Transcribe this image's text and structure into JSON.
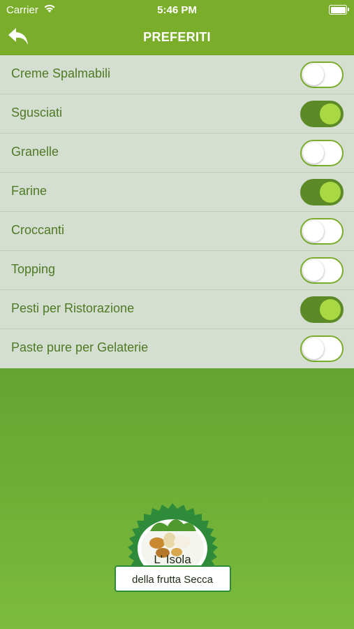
{
  "status_bar": {
    "carrier": "Carrier",
    "time": "5:46 PM"
  },
  "nav": {
    "title": "PREFERITI",
    "back_icon": "back-arrow-icon"
  },
  "items": [
    {
      "label": "Creme Spalmabili",
      "on": false
    },
    {
      "label": "Sgusciati",
      "on": true
    },
    {
      "label": "Granelle",
      "on": false
    },
    {
      "label": "Farine",
      "on": true
    },
    {
      "label": "Croccanti",
      "on": false
    },
    {
      "label": "Topping",
      "on": false
    },
    {
      "label": "Pesti per Ristorazione",
      "on": true
    },
    {
      "label": "Paste pure per Gelaterie",
      "on": false
    }
  ],
  "logo": {
    "line1": "L' Isola",
    "line2": "della frutta Secca"
  },
  "colors": {
    "bar": "#7aae2a",
    "text": "#4d7a23",
    "toggle_on": "#5c8a26",
    "knob_on": "#a8d842"
  }
}
